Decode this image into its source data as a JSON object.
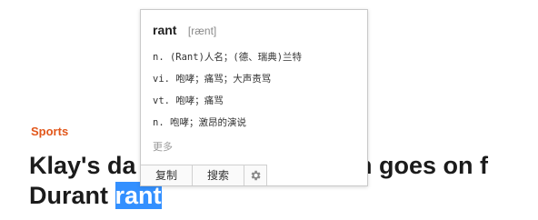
{
  "article": {
    "section": "Sports",
    "headline_line1_start": "Klay's da",
    "headline_line1_end": "Thompson goes on f",
    "headline_line2_before": "Durant ",
    "selected_word": "rant"
  },
  "popup": {
    "word": "rant",
    "phonetic": "[rænt]",
    "definitions": [
      "n. (Rant)人名；(德、瑞典)兰特",
      "vi. 咆哮；痛骂；大声责骂",
      "vt. 咆哮；痛骂",
      "n. 咆哮；激昂的演说"
    ],
    "more": "更多",
    "copy_label": "复制",
    "search_label": "搜索",
    "settings_icon": "gear-icon"
  },
  "colors": {
    "section": "#e2571b",
    "selection": "#3390ff"
  }
}
